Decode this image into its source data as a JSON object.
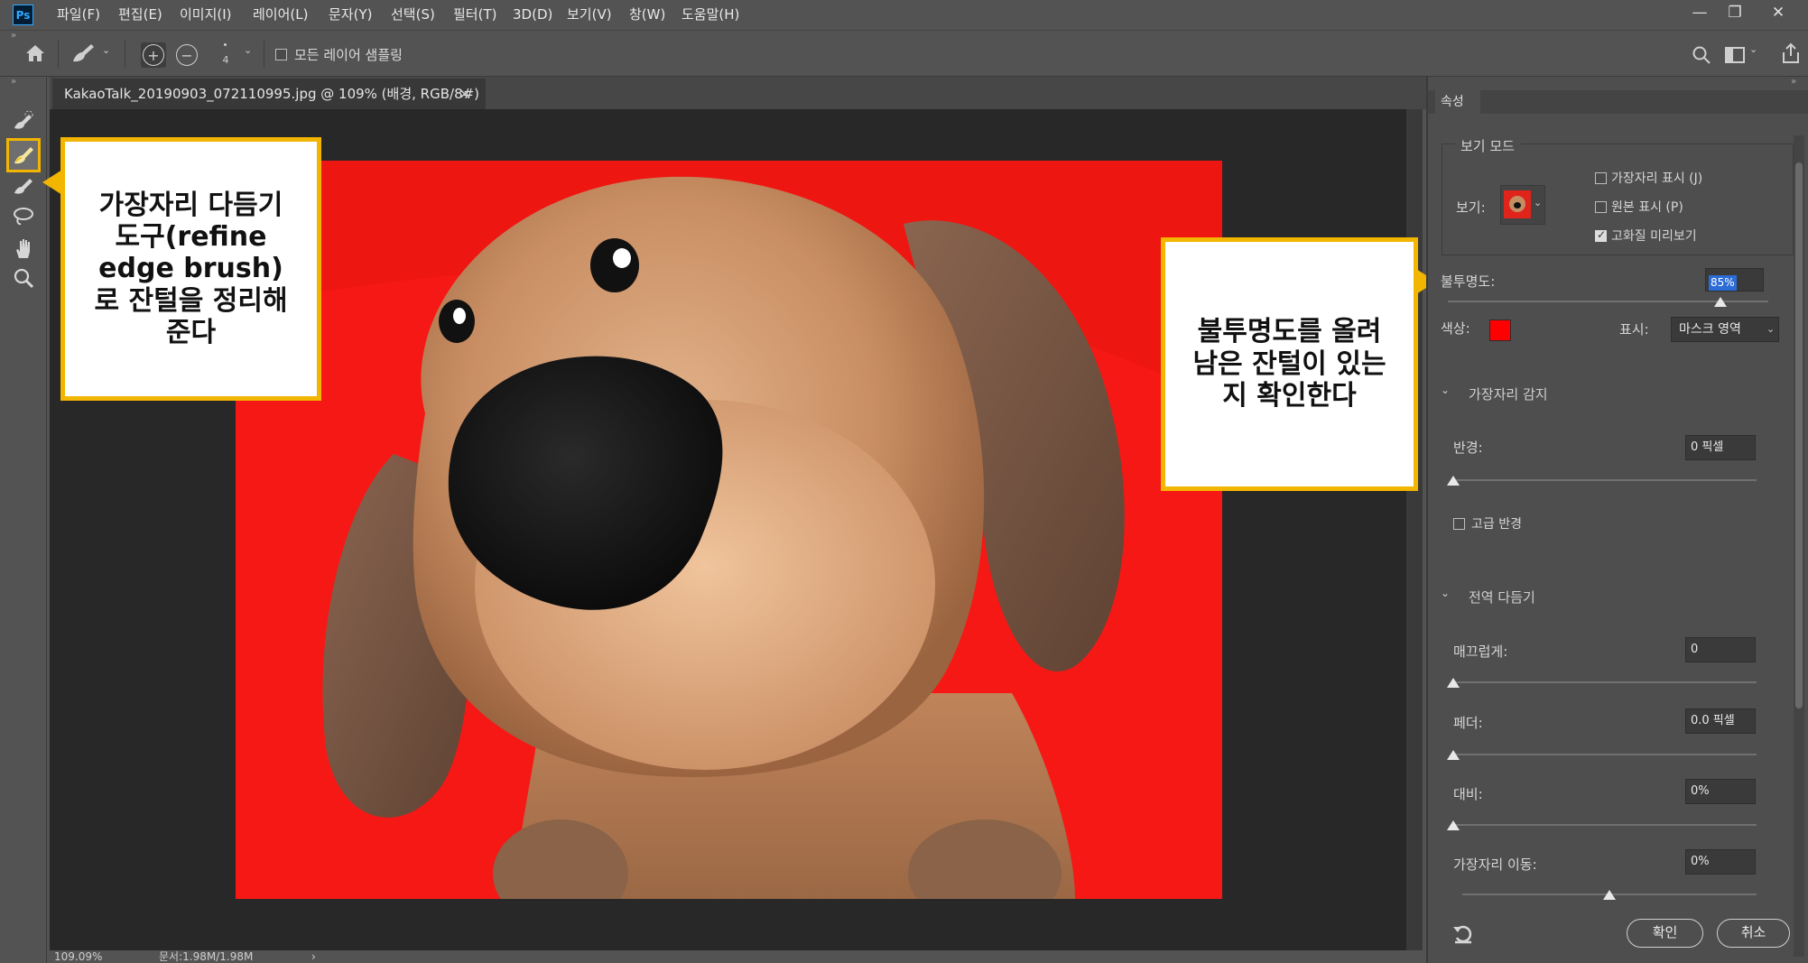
{
  "app": {
    "logo": "Ps"
  },
  "menu": [
    "파일(F)",
    "편집(E)",
    "이미지(I)",
    "레이어(L)",
    "문자(Y)",
    "선택(S)",
    "필터(T)",
    "3D(D)",
    "보기(V)",
    "창(W)",
    "도움말(H)"
  ],
  "window_controls": {
    "minimize": "—",
    "restore": "❐",
    "close": "✕"
  },
  "options_bar": {
    "brush_size": "4",
    "sample_all_layers_label": "모든 레이어 샘플링",
    "sample_all_layers_checked": false
  },
  "document": {
    "tab_title": "KakaoTalk_20190903_072110995.jpg  @  109% (배경, RGB/8#)",
    "tab_close": "×",
    "zoom": "109.09%",
    "doc_size": "문서:1.98M/1.98M",
    "status_arrow": "›"
  },
  "callouts": {
    "left": "가장자리 다듬기\n도구(refine\nedge brush)\n로 잔털을 정리해\n준다",
    "right": "불투명도를 올려\n남은 잔털이 있는\n지 확인한다"
  },
  "properties": {
    "tab_label": "속성",
    "view_mode": {
      "group_label": "보기 모드",
      "view_label": "보기:",
      "show_edge": {
        "label": "가장자리 표시 (J)",
        "checked": false
      },
      "show_original": {
        "label": "원본 표시 (P)",
        "checked": false
      },
      "high_quality_preview": {
        "label": "고화질 미리보기",
        "checked": true
      }
    },
    "opacity": {
      "label": "불투명도:",
      "value": "85%",
      "level": 0.85
    },
    "color": {
      "label": "색상:",
      "value": "#ff0000"
    },
    "display": {
      "label": "표시:",
      "value": "마스크 영역"
    },
    "edge_detection": {
      "header": "가장자리 감지",
      "radius": {
        "label": "반경:",
        "value": "0 픽셀",
        "level": 0
      },
      "smart_radius": {
        "label": "고급 반경",
        "checked": false
      }
    },
    "global_refine": {
      "header": "전역 다듬기",
      "smooth": {
        "label": "매끄럽게:",
        "value": "0",
        "level": 0
      },
      "feather": {
        "label": "페더:",
        "value": "0.0 픽셀",
        "level": 0
      },
      "contrast": {
        "label": "대비:",
        "value": "0%",
        "level": 0
      },
      "shift_edge": {
        "label": "가장자리 이동:",
        "value": "0%",
        "level": 0.5
      }
    },
    "buttons": {
      "ok": "확인",
      "cancel": "취소"
    }
  }
}
